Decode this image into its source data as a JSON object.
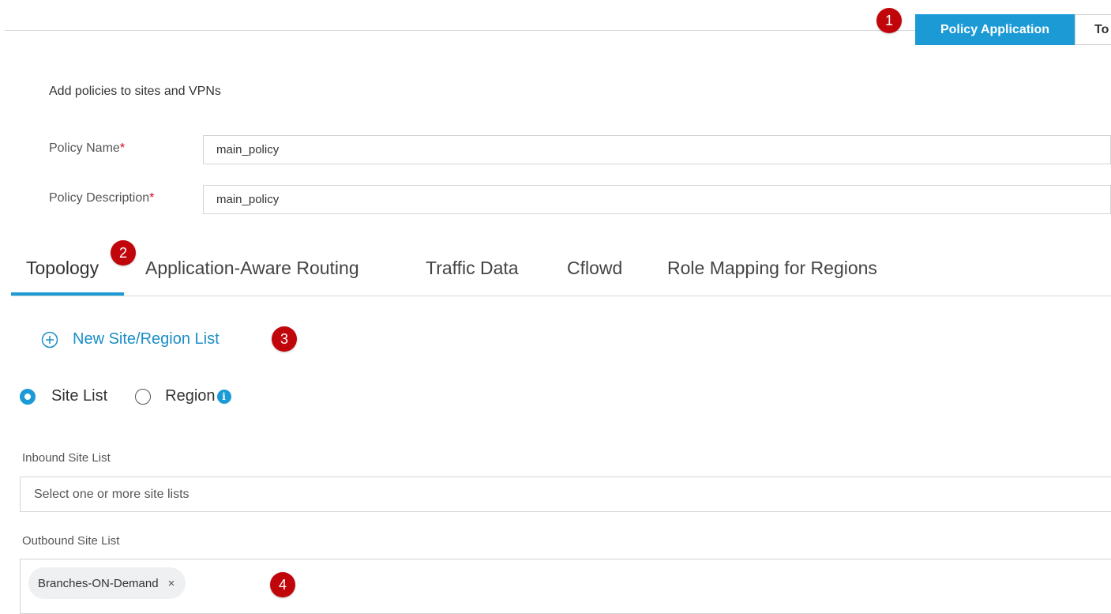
{
  "header": {
    "active_button": "Policy Application",
    "next_button_partial": "To"
  },
  "badges": [
    "1",
    "2",
    "3",
    "4"
  ],
  "subtitle": "Add policies to sites and VPNs",
  "form": {
    "policy_name_label": "Policy Name",
    "policy_name_value": "main_policy",
    "policy_description_label": "Policy Description",
    "policy_description_value": "main_policy",
    "required_mark": "*"
  },
  "tabs": [
    {
      "label": "Topology",
      "active": true
    },
    {
      "label": "Application-Aware Routing",
      "active": false
    },
    {
      "label": "Traffic Data",
      "active": false
    },
    {
      "label": "Cflowd",
      "active": false
    },
    {
      "label": "Role Mapping for Regions",
      "active": false
    }
  ],
  "new_list": {
    "label": "New Site/Region List",
    "icon": "plus-circle-icon"
  },
  "radio": {
    "site_list_label": "Site List",
    "region_label": "Region",
    "selected": "Site List"
  },
  "inbound": {
    "label": "Inbound Site List",
    "placeholder": "Select one or more site lists"
  },
  "outbound": {
    "label": "Outbound Site List",
    "chips": [
      {
        "label": "Branches-ON-Demand",
        "remove": "×"
      }
    ]
  },
  "colors": {
    "accent": "#1b9ad6",
    "badge": "#c0060b",
    "required": "#d0021b"
  }
}
